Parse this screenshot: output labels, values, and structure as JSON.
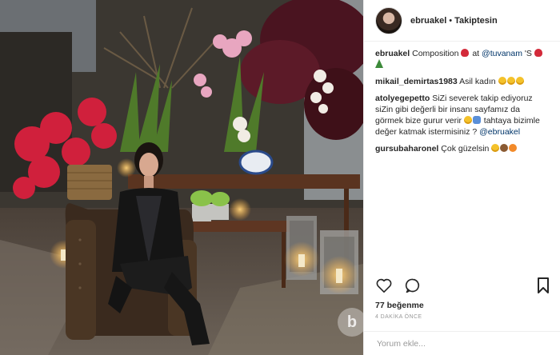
{
  "post": {
    "username": "ebruakel",
    "separator": "•",
    "follow_status": "Takiptesin",
    "caption_text": "Composition",
    "caption_at": "at",
    "caption_mention": "@tuvanam",
    "caption_tail": "'S"
  },
  "comments": [
    {
      "user": "mikail_demirtas1983",
      "text": "Asil kadın"
    },
    {
      "user": "atolyegepetto",
      "text": "SiZi severek takip ediyoruz siZin gibi değerli bir insanı sayfamız da görmek bize gurur verir",
      "text2": "tahtaya bizimle değer katmak istermisiniz ?",
      "mention": "@ebruakel"
    },
    {
      "user": "gursubaharonel",
      "text": "Çok güzelsin"
    }
  ],
  "actions": {
    "like_icon": "heart-icon",
    "comment_icon": "speech-bubble-icon",
    "save_icon": "bookmark-icon"
  },
  "likes": "77 beğenme",
  "timestamp": "4 DAKİKA ÖNCE",
  "comment_input": {
    "placeholder": "Yorum ekle..."
  },
  "colors": {
    "mention": "#003569",
    "border": "#efefef",
    "text": "#262626",
    "muted": "#999999"
  }
}
